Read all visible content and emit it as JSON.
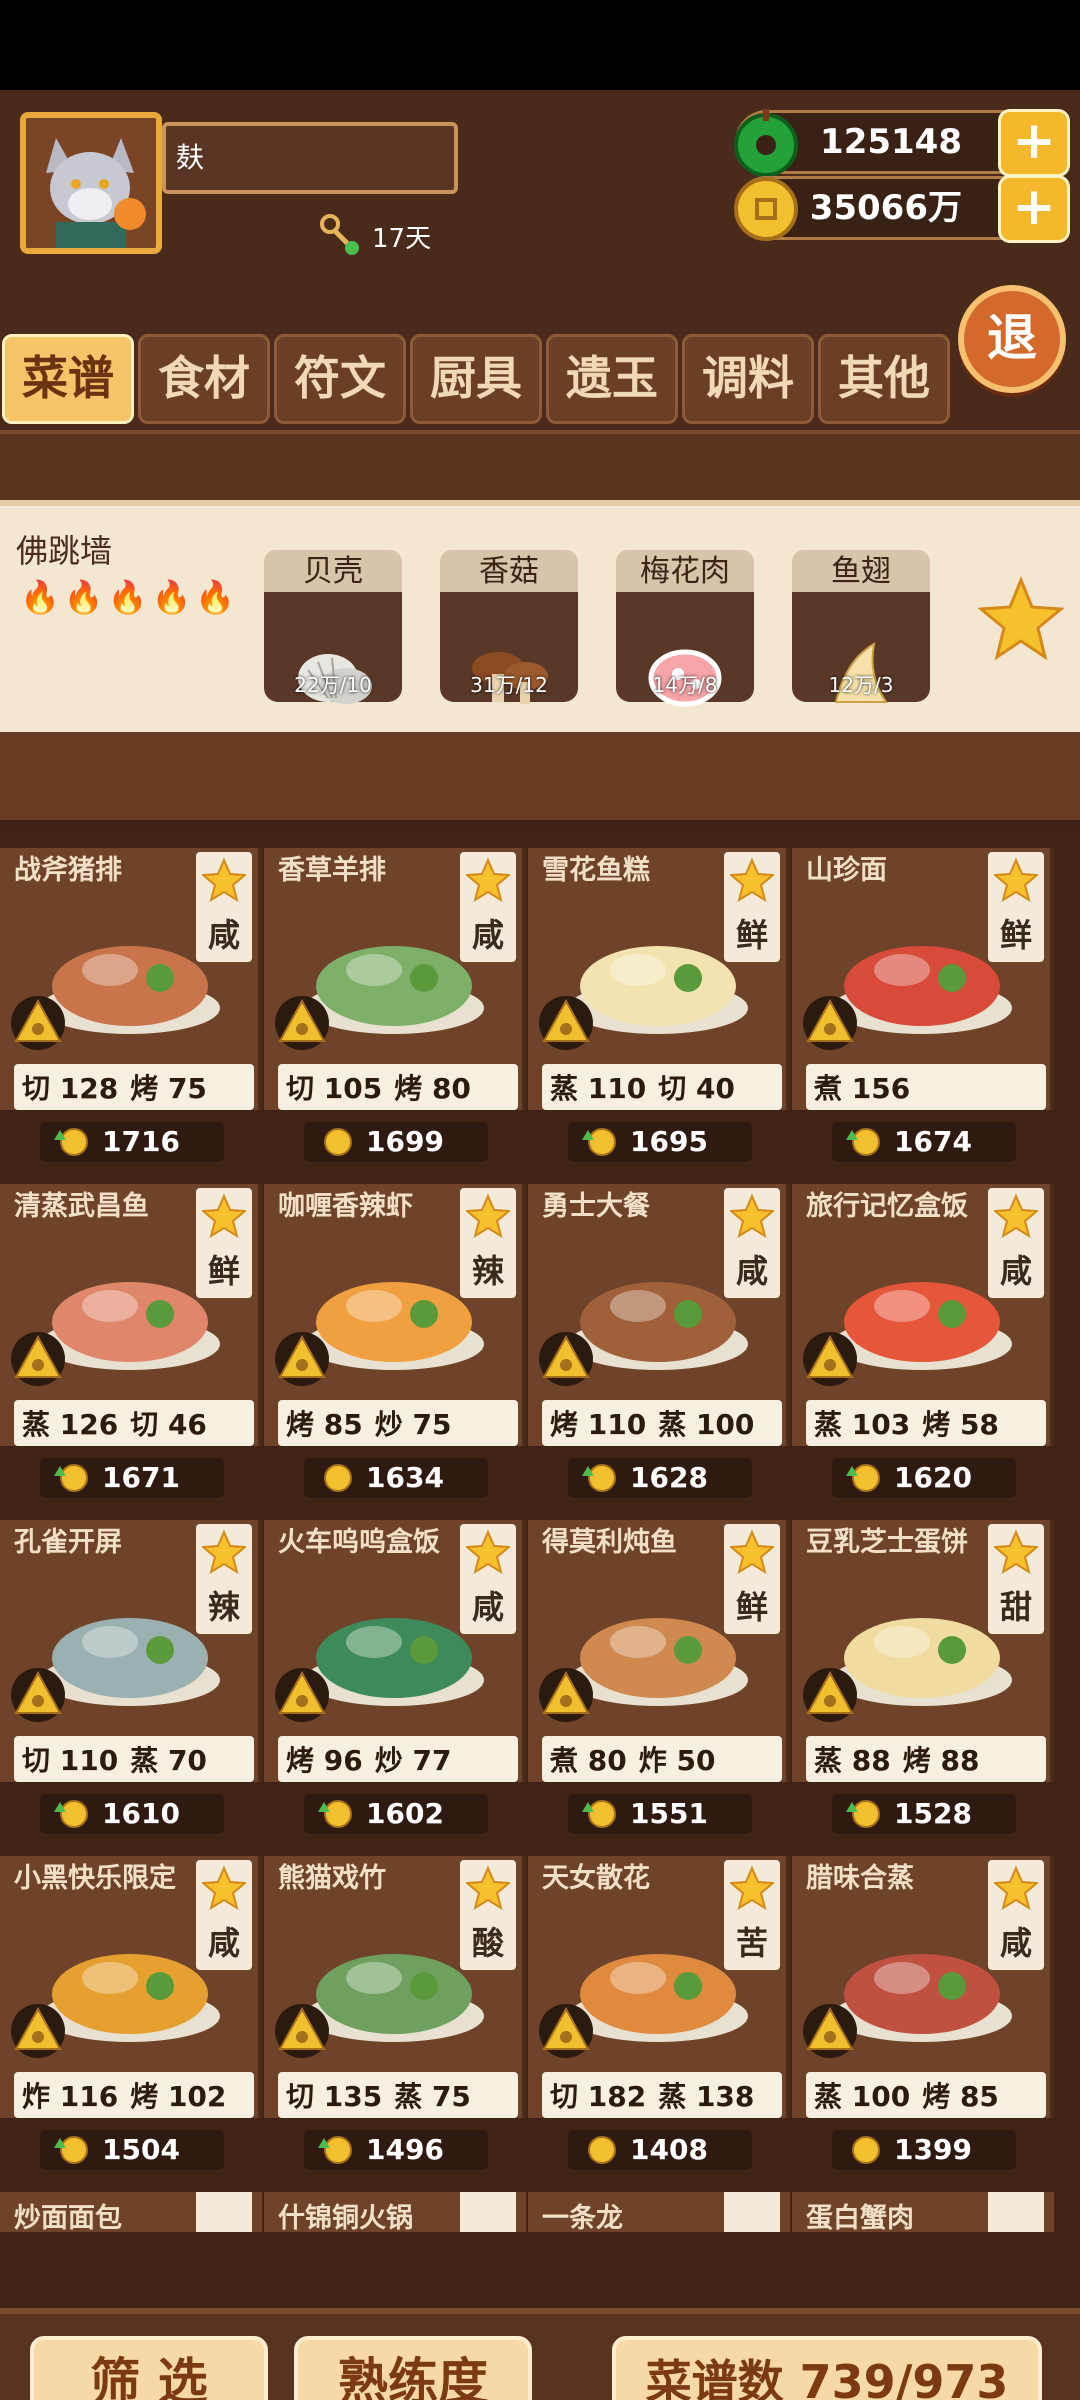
{
  "player": {
    "name": "麸",
    "days": "17天",
    "jade": "125148",
    "gold": "35066万"
  },
  "exit_label": "退",
  "tabs": [
    "菜谱",
    "食材",
    "符文",
    "厨具",
    "遗玉",
    "调料",
    "其他"
  ],
  "selected_recipe": {
    "name": "佛跳墙",
    "flames": 5,
    "ingredients": [
      {
        "name": "贝壳",
        "count": "22万/10"
      },
      {
        "name": "香菇",
        "count": "31万/12"
      },
      {
        "name": "梅花肉",
        "count": "14万/8"
      },
      {
        "name": "鱼翅",
        "count": "12万/3"
      }
    ]
  },
  "recipes": [
    {
      "name": "战斧猪排",
      "taste": "咸",
      "skills": [
        [
          "切",
          "128"
        ],
        [
          "烤",
          "75"
        ]
      ],
      "price": "1716",
      "up": true
    },
    {
      "name": "香草羊排",
      "taste": "咸",
      "skills": [
        [
          "切",
          "105"
        ],
        [
          "烤",
          "80"
        ]
      ],
      "price": "1699",
      "up": false
    },
    {
      "name": "雪花鱼糕",
      "taste": "鲜",
      "skills": [
        [
          "蒸",
          "110"
        ],
        [
          "切",
          "40"
        ]
      ],
      "price": "1695",
      "up": true
    },
    {
      "name": "山珍面",
      "taste": "鲜",
      "skills": [
        [
          "煮",
          "156"
        ]
      ],
      "price": "1674",
      "up": true
    },
    {
      "name": "清蒸武昌鱼",
      "taste": "鲜",
      "skills": [
        [
          "蒸",
          "126"
        ],
        [
          "切",
          "46"
        ]
      ],
      "price": "1671",
      "up": true
    },
    {
      "name": "咖喱香辣虾",
      "taste": "辣",
      "skills": [
        [
          "烤",
          "85"
        ],
        [
          "炒",
          "75"
        ]
      ],
      "price": "1634",
      "up": false
    },
    {
      "name": "勇士大餐",
      "taste": "咸",
      "skills": [
        [
          "烤",
          "110"
        ],
        [
          "蒸",
          "100"
        ]
      ],
      "price": "1628",
      "up": true
    },
    {
      "name": "旅行记忆盒饭",
      "taste": "咸",
      "skills": [
        [
          "蒸",
          "103"
        ],
        [
          "烤",
          "58"
        ]
      ],
      "price": "1620",
      "up": true
    },
    {
      "name": "孔雀开屏",
      "taste": "辣",
      "skills": [
        [
          "切",
          "110"
        ],
        [
          "蒸",
          "70"
        ]
      ],
      "price": "1610",
      "up": true
    },
    {
      "name": "火车呜呜盒饭",
      "taste": "咸",
      "skills": [
        [
          "烤",
          "96"
        ],
        [
          "炒",
          "77"
        ]
      ],
      "price": "1602",
      "up": true
    },
    {
      "name": "得莫利炖鱼",
      "taste": "鲜",
      "skills": [
        [
          "煮",
          "80"
        ],
        [
          "炸",
          "50"
        ]
      ],
      "price": "1551",
      "up": true
    },
    {
      "name": "豆乳芝士蛋饼",
      "taste": "甜",
      "skills": [
        [
          "蒸",
          "88"
        ],
        [
          "烤",
          "88"
        ]
      ],
      "price": "1528",
      "up": true
    },
    {
      "name": "小黑快乐限定",
      "taste": "咸",
      "skills": [
        [
          "炸",
          "116"
        ],
        [
          "烤",
          "102"
        ]
      ],
      "price": "1504",
      "up": true
    },
    {
      "name": "熊猫戏竹",
      "taste": "酸",
      "skills": [
        [
          "切",
          "135"
        ],
        [
          "蒸",
          "75"
        ]
      ],
      "price": "1496",
      "up": true
    },
    {
      "name": "天女散花",
      "taste": "苦",
      "skills": [
        [
          "切",
          "182"
        ],
        [
          "蒸",
          "138"
        ]
      ],
      "price": "1408",
      "up": false
    },
    {
      "name": "腊味合蒸",
      "taste": "咸",
      "skills": [
        [
          "蒸",
          "100"
        ],
        [
          "烤",
          "85"
        ]
      ],
      "price": "1399",
      "up": false
    }
  ],
  "next_row": [
    "炒面面包",
    "什锦铜火锅",
    "一条龙",
    "蛋白蟹肉"
  ],
  "bottom": {
    "filter": "筛 选",
    "mastery": "熟练度",
    "count": "菜谱数 739/973"
  },
  "colors": {
    "accent": "#f6c56a",
    "wood": "#6e4329",
    "dark": "#3f2416"
  }
}
